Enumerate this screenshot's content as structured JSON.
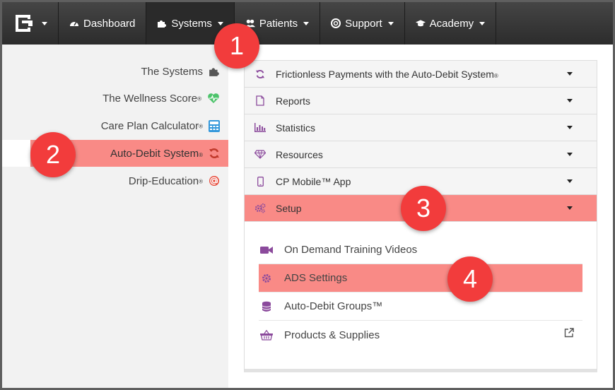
{
  "nav": {
    "items": [
      {
        "label": "Dashboard",
        "icon": "dashboard-icon"
      },
      {
        "label": "Systems",
        "icon": "puzzle-icon"
      },
      {
        "label": "Patients",
        "icon": "users-icon"
      },
      {
        "label": "Support",
        "icon": "lifebuoy-icon"
      },
      {
        "label": "Academy",
        "icon": "graduation-cap-icon"
      }
    ]
  },
  "sidebar": {
    "items": [
      {
        "label": "The Systems",
        "icon": "puzzle-icon"
      },
      {
        "label": "The Wellness Score",
        "reg": "®",
        "icon": "heartbeat-icon"
      },
      {
        "label": "Care Plan Calculator",
        "reg": "®",
        "icon": "calculator-icon"
      },
      {
        "label": "Auto-Debit System",
        "reg": "®",
        "icon": "refresh-icon"
      },
      {
        "label": "Drip-Education",
        "reg": "®",
        "icon": "at-icon"
      }
    ]
  },
  "panel": {
    "sections": [
      {
        "label": "Frictionless Payments with the Auto-Debit System",
        "reg": "®",
        "icon": "refresh-icon"
      },
      {
        "label": "Reports",
        "icon": "file-icon"
      },
      {
        "label": "Statistics",
        "icon": "bar-chart-icon"
      },
      {
        "label": "Resources",
        "icon": "diamond-icon"
      },
      {
        "label": "CP Mobile™ App",
        "icon": "mobile-icon"
      },
      {
        "label": "Setup",
        "icon": "cogs-icon"
      }
    ],
    "setup_items": [
      {
        "label": "On Demand Training Videos",
        "icon": "video-camera-icon"
      },
      {
        "label": "ADS Settings",
        "icon": "gear-icon"
      },
      {
        "label": "Auto-Debit Groups™",
        "icon": "database-icon"
      },
      {
        "label": "Products & Supplies",
        "icon": "basket-icon"
      }
    ]
  },
  "badges": [
    "1",
    "2",
    "3",
    "4"
  ],
  "colors": {
    "highlight": "#f98a86",
    "badge": "#f23c3c",
    "accent_purple": "#8b4a9c",
    "accent_red": "#e74c3c",
    "accent_green": "#4cc36a",
    "accent_blue": "#3498db"
  }
}
